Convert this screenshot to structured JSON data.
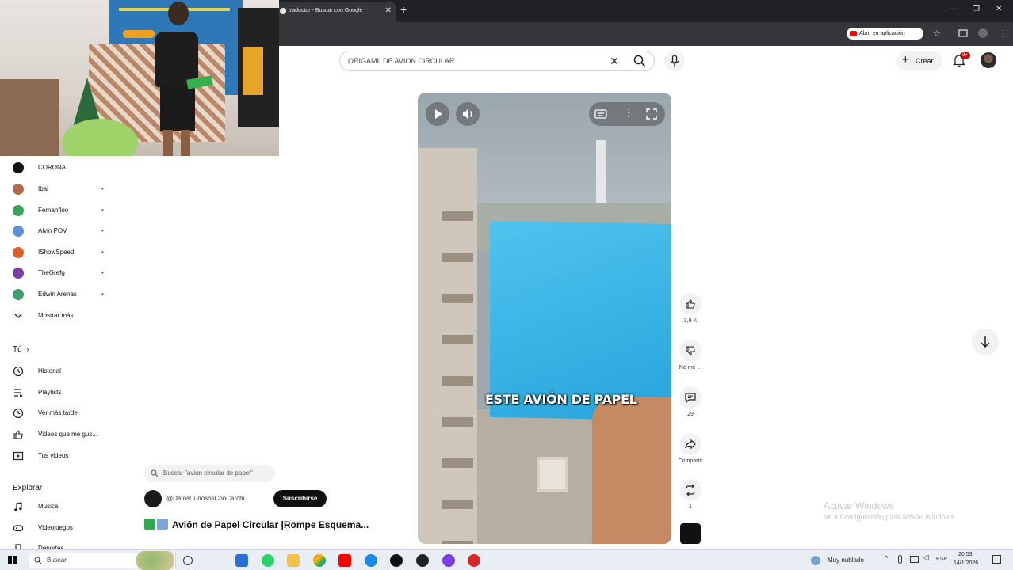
{
  "browser": {
    "tab_title": "traductor - Buscar con Google",
    "tab_close": "✕",
    "new_tab": "+",
    "open_app_label": "Abrir en aplicación",
    "window_controls": [
      "—",
      "❐",
      "✕"
    ]
  },
  "header": {
    "search_value": "ORIGAMII DE AVION CIRCULAR",
    "create_label": "Crear",
    "notification_count": "9+"
  },
  "sidebar": {
    "subscriptions": [
      {
        "label": "CORONA",
        "color": "#111111"
      },
      {
        "label": "Ibai",
        "color": "#b36a4a"
      },
      {
        "label": "Fernanfloo",
        "color": "#3aa35a"
      },
      {
        "label": "Alvin POV",
        "color": "#5b8fd6"
      },
      {
        "label": "IShowSpeed",
        "color": "#d9602a"
      },
      {
        "label": "TheGrefg",
        "color": "#7a3ea8"
      },
      {
        "label": "Edwin Arenas",
        "color": "#3f9e6f"
      }
    ],
    "show_more": "Mostrar más",
    "you_title": "Tú",
    "you_items": [
      "Historial",
      "Playlists",
      "Ver más tarde",
      "Videos que me gus...",
      "Tus videos"
    ],
    "explore_title": "Explorar",
    "explore_items": [
      "Música",
      "Videojuegos",
      "Deportes"
    ]
  },
  "shorts": {
    "related_search": "Buscar \"avion circular de papel\"",
    "channel_handle": "@DatosCuriososConCarchi",
    "subscribe_label": "Suscribirse",
    "title": "Avión de Papel Circular |Rompe Esquema...",
    "caption": "ESTE AVIÓN DE PAPEL",
    "actions": [
      {
        "name": "like",
        "count": "3,9 K"
      },
      {
        "name": "dislike",
        "count": "No me ..."
      },
      {
        "name": "comments",
        "count": "29"
      },
      {
        "name": "share",
        "count": "Compartir"
      },
      {
        "name": "remix",
        "count": "1"
      }
    ]
  },
  "watermark": {
    "line1": "Activar Windows",
    "line2": "Ve a Configuración para activar Windows."
  },
  "taskbar": {
    "search_placeholder": "Buscar",
    "weather": "Muy nublado",
    "time": "20:53",
    "date": "14/1/2026"
  }
}
